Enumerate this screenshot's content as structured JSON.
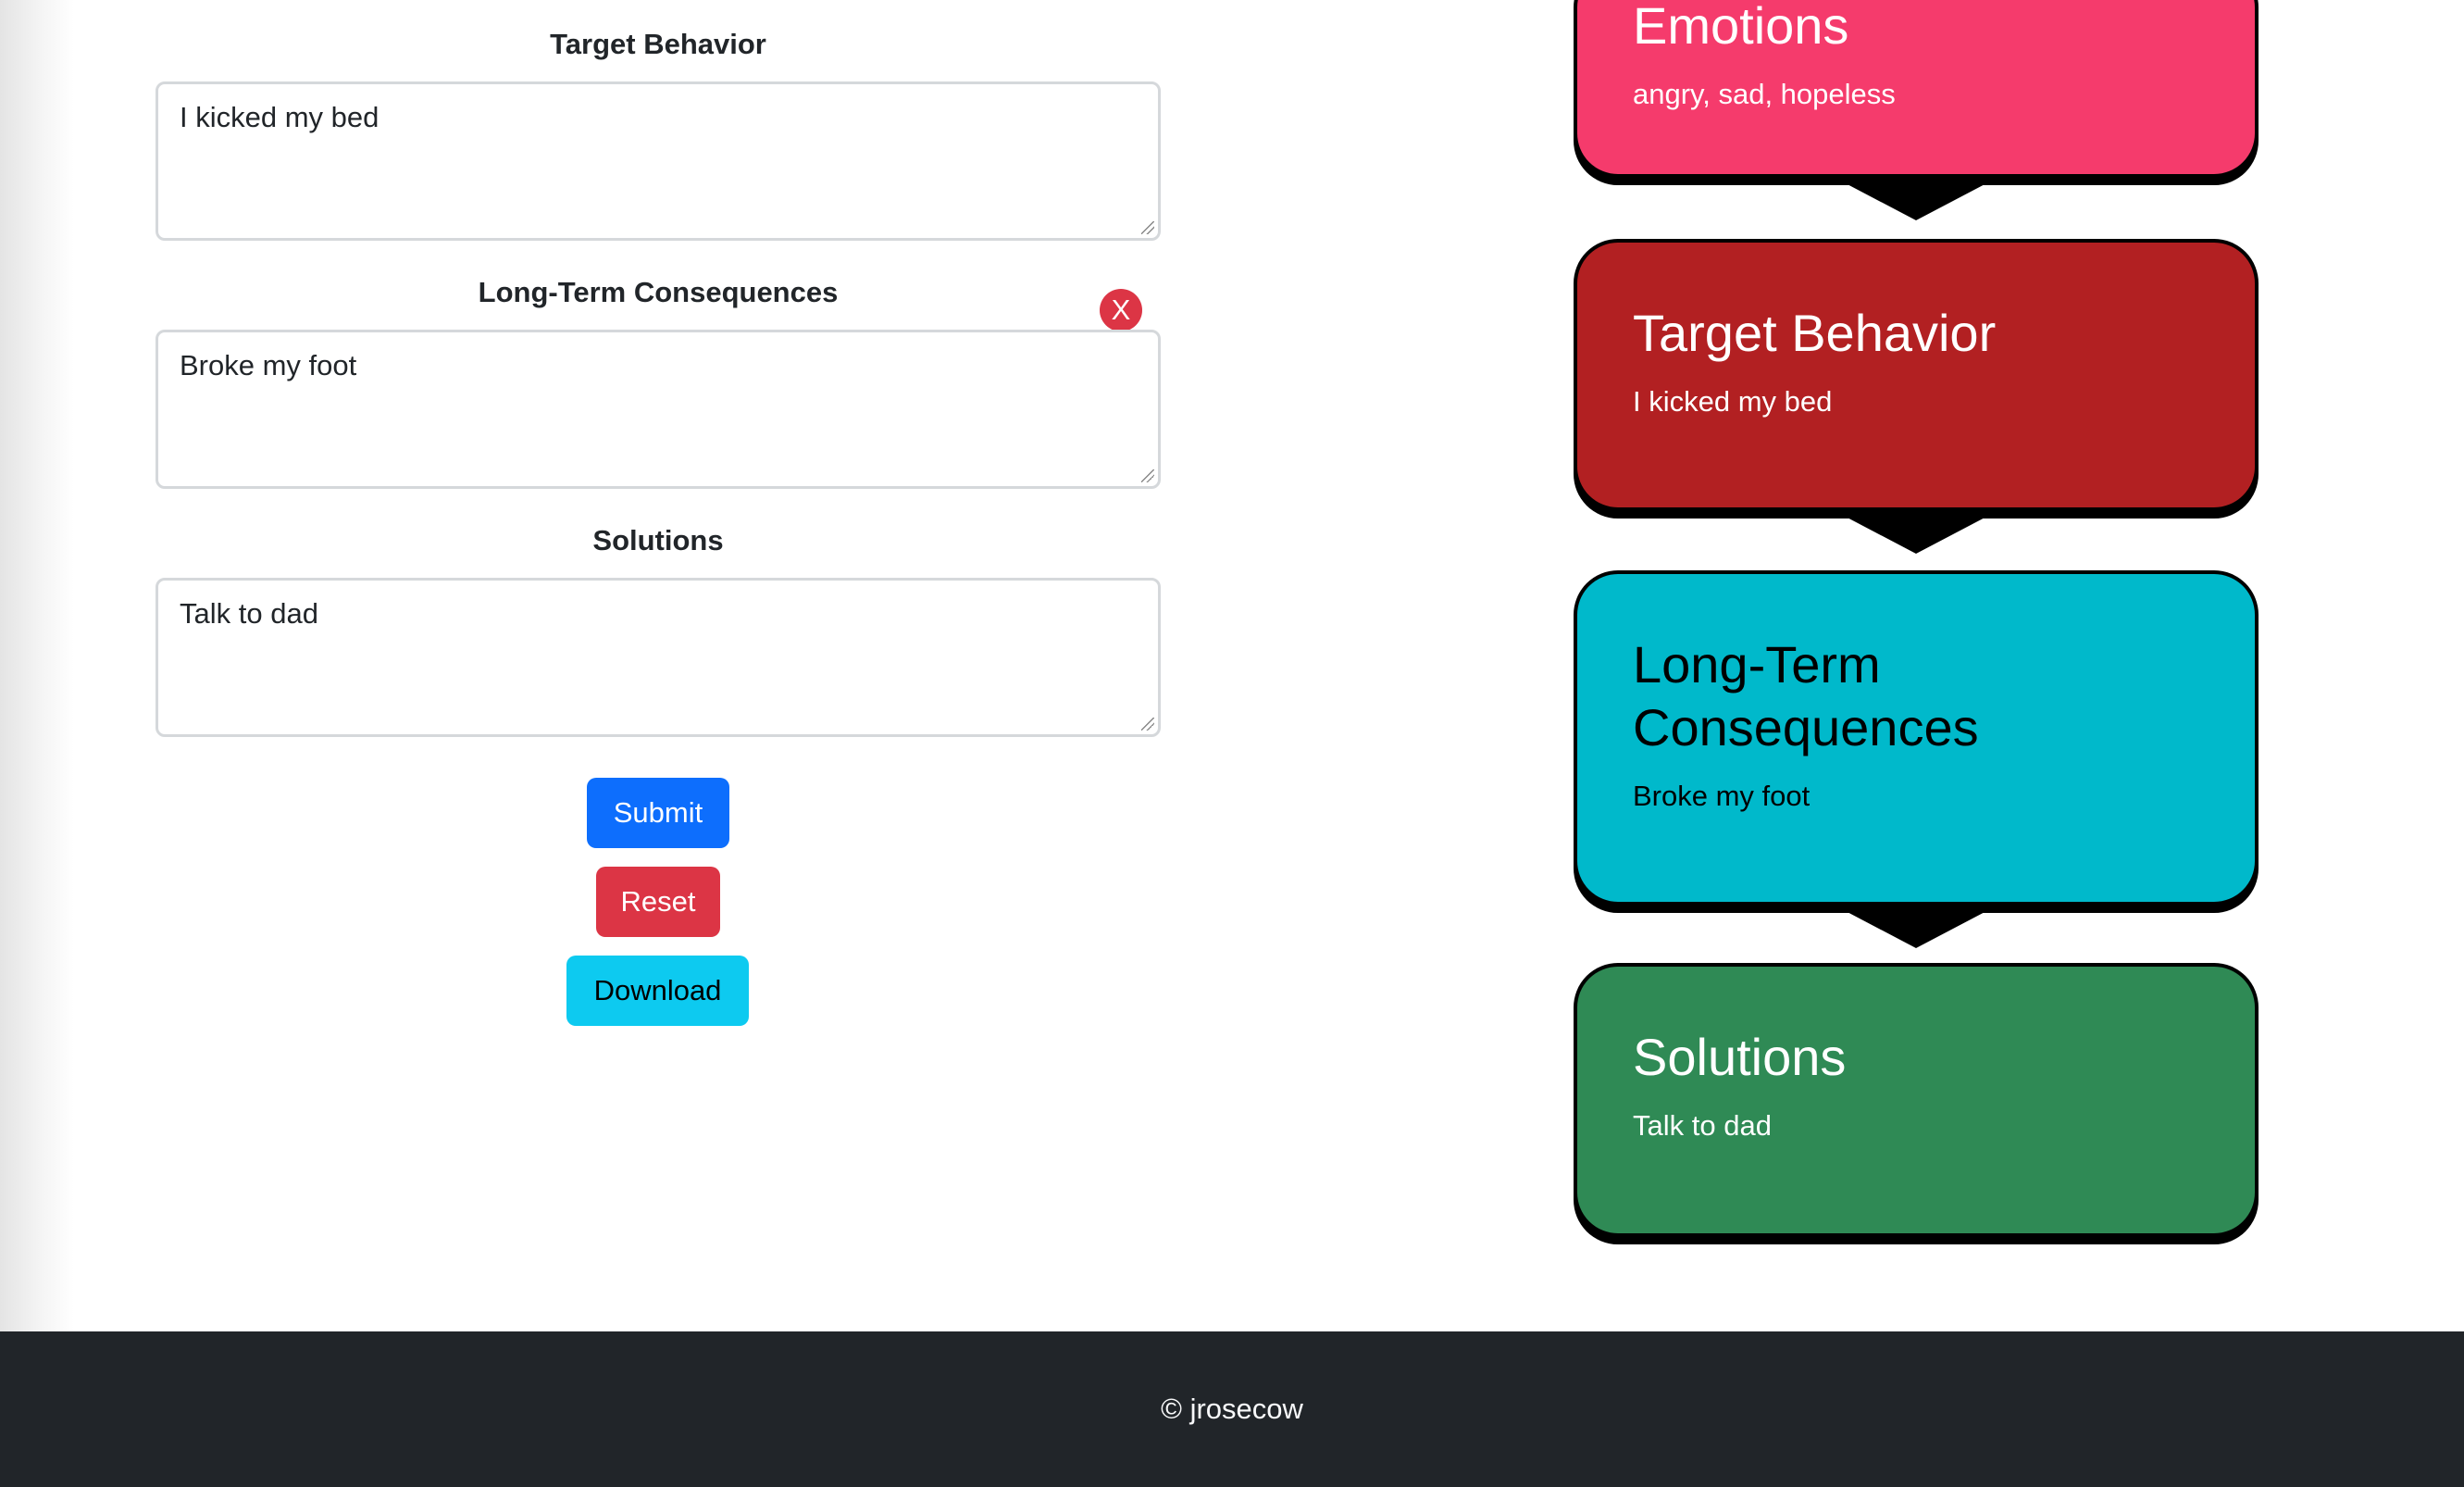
{
  "form": {
    "fields": [
      {
        "label": "Target Behavior",
        "value": "I kicked my bed"
      },
      {
        "label": "Long-Term Consequences",
        "value": "Broke my foot"
      },
      {
        "label": "Solutions",
        "value": "Talk to dad"
      }
    ],
    "remove_label": "X",
    "buttons": {
      "submit": "Submit",
      "reset": "Reset",
      "download": "Download"
    }
  },
  "chain": {
    "cards": [
      {
        "title": "Emotions",
        "text": "angry, sad, hopeless",
        "color": "#f53b6c"
      },
      {
        "title": "Target Behavior",
        "text": "I kicked my bed",
        "color": "#b22022"
      },
      {
        "title": "Long-Term Consequences",
        "text": "Broke my foot",
        "color": "#00b9cb"
      },
      {
        "title": "Solutions",
        "text": "Talk to dad",
        "color": "#2f8a55"
      }
    ]
  },
  "footer": {
    "text": "© jrosecow"
  },
  "colors": {
    "primary": "#0d6efd",
    "danger": "#dc3545",
    "info": "#0dcaf0",
    "footer_bg": "#212529"
  }
}
